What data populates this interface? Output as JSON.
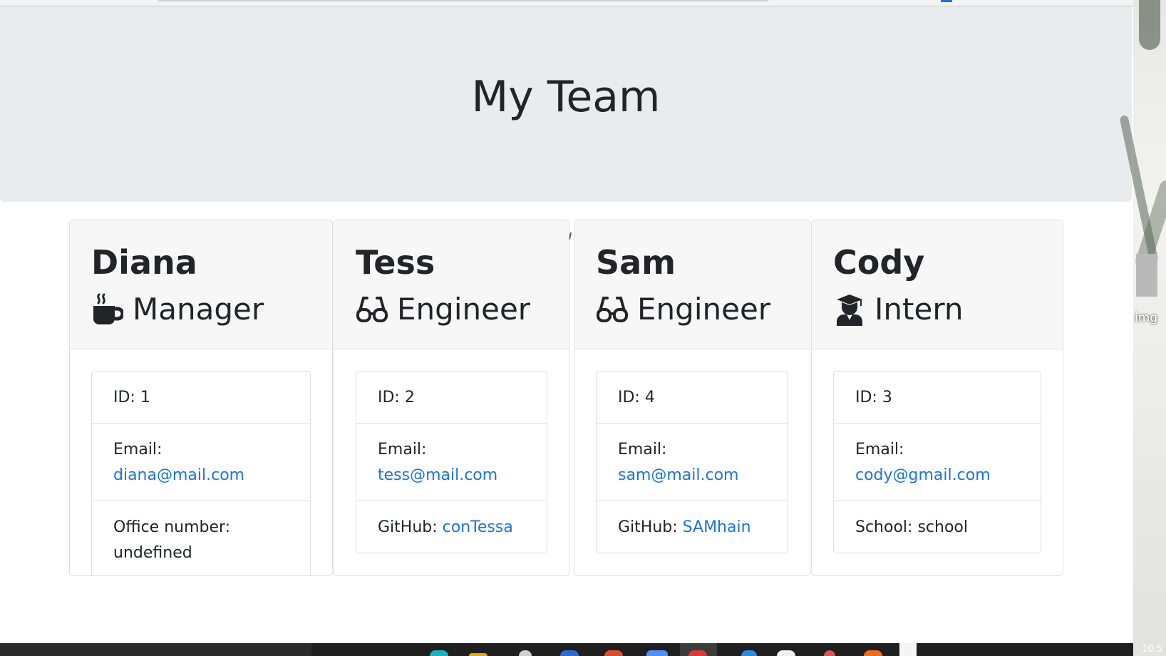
{
  "header": {
    "title": "My Team"
  },
  "team": [
    {
      "name": "Diana",
      "role": "Manager",
      "icon": "coffee-icon",
      "id_text": "ID: 1",
      "email_label": "Email:",
      "email": "diana@mail.com",
      "extra_label": "Office number:",
      "extra_value": "undefined"
    },
    {
      "name": "Tess",
      "role": "Engineer",
      "icon": "glasses-icon",
      "id_text": "ID: 2",
      "email_label": "Email:",
      "email": "tess@mail.com",
      "extra_label": "GitHub:",
      "extra_value": "conTessa"
    },
    {
      "name": "Sam",
      "role": "Engineer",
      "icon": "glasses-icon",
      "id_text": "ID: 4",
      "email_label": "Email:",
      "email": "sam@mail.com",
      "extra_label": "GitHub:",
      "extra_value": "SAMhain"
    },
    {
      "name": "Cody",
      "role": "Intern",
      "icon": "graduate-icon",
      "id_text": "ID: 3",
      "email_label": "Email:",
      "email": "cody@gmail.com",
      "extra_label": "School:",
      "extra_value": "school"
    }
  ],
  "desktop": {
    "icon_label": "img",
    "clock": "10:5"
  },
  "colors": {
    "jumbotron": "#e9ecef",
    "link": "#1a73e8",
    "card_header": "#f7f7f7"
  }
}
